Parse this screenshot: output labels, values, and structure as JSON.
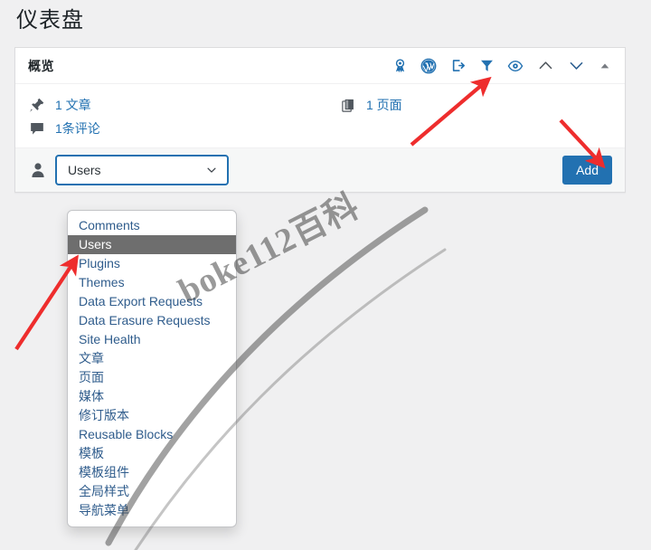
{
  "page": {
    "title": "仪表盘"
  },
  "card": {
    "header_title": "概览",
    "header_icons": [
      {
        "name": "award-icon",
        "label": "award"
      },
      {
        "name": "wordpress-icon",
        "label": "WordPress"
      },
      {
        "name": "logout-icon",
        "label": "logout"
      },
      {
        "name": "filter-icon",
        "label": "filter"
      },
      {
        "name": "eye-icon",
        "label": "preview"
      },
      {
        "name": "chevron-up-icon",
        "label": "move up"
      },
      {
        "name": "chevron-down-icon",
        "label": "move down"
      },
      {
        "name": "triangle-up-icon",
        "label": "toggle panel"
      }
    ],
    "accent_color": "#2271b1",
    "stats": [
      {
        "icon": "pin-icon",
        "text": "1 文章"
      },
      {
        "icon": "pages-icon",
        "text": "1 页面"
      },
      {
        "icon": "comment-icon",
        "text": "1条评论"
      }
    ]
  },
  "select_row": {
    "user_icon": "user-icon",
    "selected_value": "Users",
    "caret_icon": "chevron-down-icon",
    "add_label": "Add"
  },
  "dropdown": {
    "selected": "Users",
    "options": [
      "Comments",
      "Users",
      "Plugins",
      "Themes",
      "Data Export Requests",
      "Data Erasure Requests",
      "Site Health",
      "文章",
      "页面",
      "媒体",
      "修订版本",
      "Reusable Blocks",
      "模板",
      "模板组件",
      "全局样式",
      "导航菜单"
    ]
  },
  "watermark": {
    "text": "boke112百科"
  },
  "annotations": {
    "arrow_color": "#ee2d2d",
    "arrows": [
      {
        "name": "arrow-to-filter-icon",
        "points_to": "filter-icon"
      },
      {
        "name": "arrow-to-add-button",
        "points_to": "add-button"
      },
      {
        "name": "arrow-to-dropdown-options",
        "points_to": "dropdown-option-plugins"
      }
    ]
  }
}
